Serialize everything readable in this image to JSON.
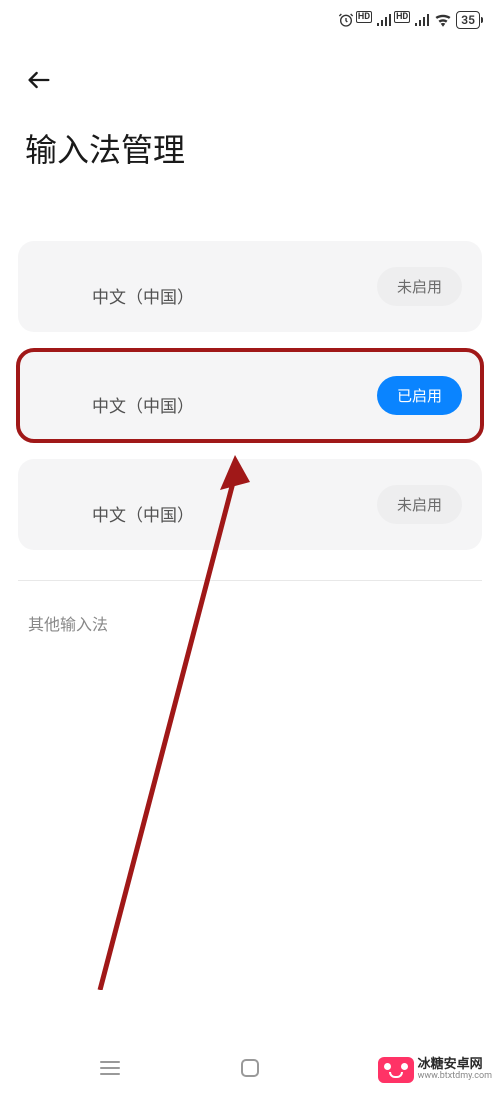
{
  "status_bar": {
    "battery_level": "35"
  },
  "header": {
    "title": "输入法管理"
  },
  "ime_list": [
    {
      "label": "中文（中国）",
      "status_text": "未启用",
      "status": "inactive",
      "highlighted": false
    },
    {
      "label": "中文（中国）",
      "status_text": "已启用",
      "status": "active",
      "highlighted": true
    },
    {
      "label": "中文（中国）",
      "status_text": "未启用",
      "status": "inactive",
      "highlighted": false
    }
  ],
  "sections": {
    "other_ime_label": "其他输入法"
  },
  "watermark": {
    "name": "冰糖安卓网",
    "url": "www.btxtdmy.com"
  }
}
